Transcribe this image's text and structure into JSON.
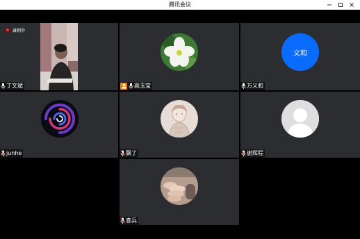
{
  "window": {
    "title": "腾讯会议",
    "minimize_icon": "minimize-icon",
    "maximize_icon": "maximize-icon",
    "close_icon": "close-icon"
  },
  "recording": {
    "label": "录制中"
  },
  "participants": [
    {
      "name": "丁文斌",
      "type": "video"
    },
    {
      "name": "高玉宝",
      "type": "avatar",
      "avatar": "white-flower",
      "host": true
    },
    {
      "name": "万义和",
      "type": "initials",
      "initials": "义和",
      "color": "#0a6cff"
    },
    {
      "name": "junhe",
      "type": "avatar",
      "avatar": "purple-swirl"
    },
    {
      "name": "飘了",
      "type": "avatar",
      "avatar": "sketch-portrait"
    },
    {
      "name": "谢辉程",
      "type": "avatar",
      "avatar": "default-person"
    },
    {
      "name": "查兵",
      "type": "avatar",
      "avatar": "hand-photo"
    }
  ],
  "colors": {
    "tile_bg": "#2b2d31",
    "host_badge": "#f08300",
    "initials_bg": "#0a6cff"
  }
}
